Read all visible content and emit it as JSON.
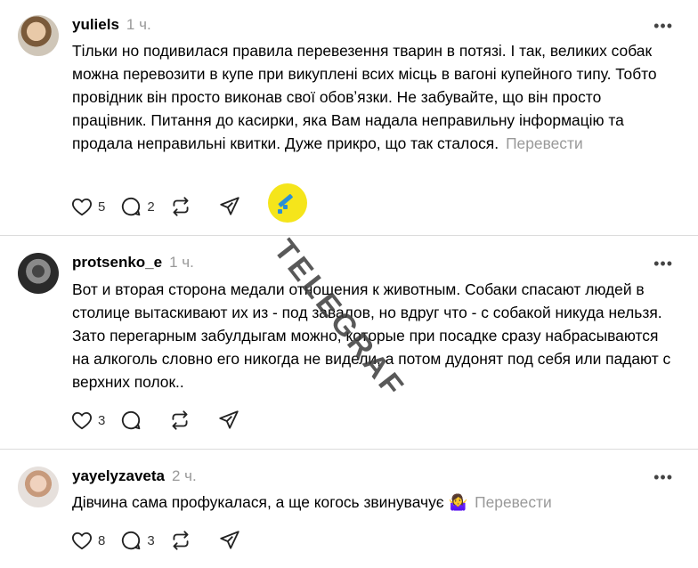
{
  "posts": [
    {
      "username": "yuliels",
      "time": "1 ч.",
      "text": "Тільки но подивилася правила перевезення тварин в потязі. І так, великих собак можна перевозити в купе при викуплені всих місць в вагоні купейного типу. Тобто провідник він просто виконав свої обовʼязки. Не забувайте, що він просто працівник. Питання до касирки, яка Вам надала неправильну інформацію та продала неправильні квитки. Дуже прикро, що так сталося.",
      "translate": "Перевести",
      "likes": "5",
      "replies": "2",
      "reposts": "",
      "avatar": "photo-avatar"
    },
    {
      "username": "protsenko_e",
      "time": "1 ч.",
      "text": "Вот и вторая сторона медали отношения к животным. Собаки спасают людей в столице вытаскивают их из - под завалов, но вдруг что - с собакой никуда нельзя. Зато перегарным забулдыгам можно, которые при посадке сразу набрасываются на алкоголь словно его никогда не видели, а потом дудонят под себя или падают с верхних полок..",
      "translate": "",
      "likes": "3",
      "replies": "",
      "reposts": "",
      "avatar": "photo-avatar"
    },
    {
      "username": "yayelyzaveta",
      "time": "2 ч.",
      "text": "Дівчина сама профукалася, а ще когось звинувачує 🤷‍♀️",
      "translate": "Перевести",
      "likes": "8",
      "replies": "3",
      "reposts": "",
      "avatar": "photo-avatar"
    }
  ],
  "more_label": "•••",
  "watermark": {
    "text": "TELEGRAF",
    "logo_color": "#f5e51b"
  },
  "icons": [
    "heart-icon",
    "comment-icon",
    "repost-icon",
    "share-icon",
    "more-icon"
  ]
}
